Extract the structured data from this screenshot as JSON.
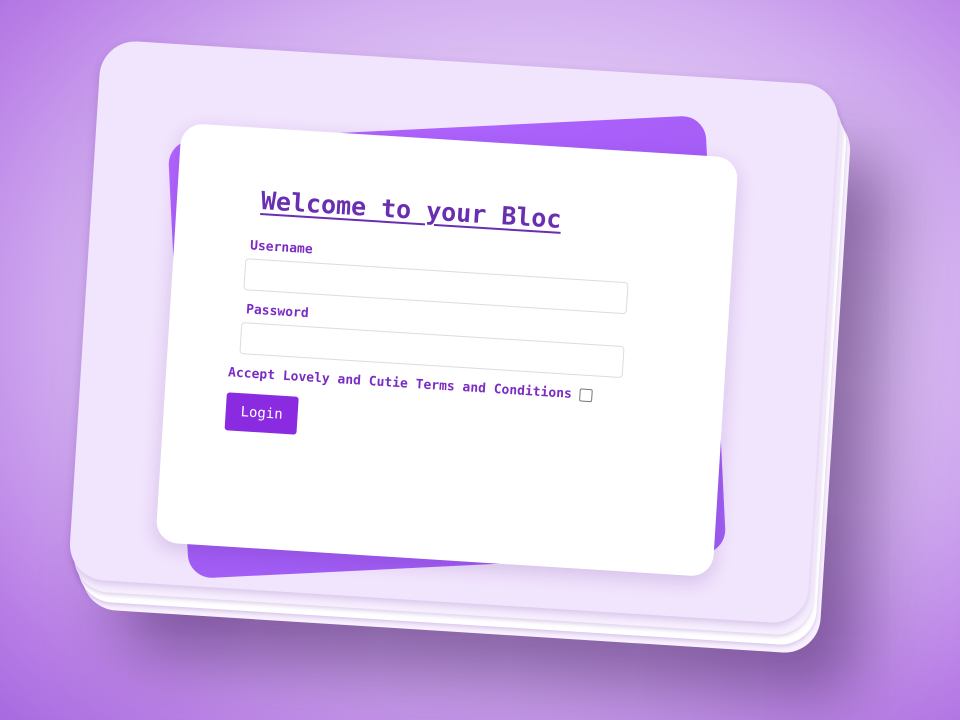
{
  "form": {
    "title": "Welcome to your Bloc",
    "username_label": "Username",
    "username_value": "",
    "password_label": "Password",
    "password_value": "",
    "terms_label": "Accept Lovely and Cutie Terms and Conditions",
    "terms_checked": false,
    "login_label": "Login"
  },
  "colors": {
    "accent": "#8a2be2",
    "label_text": "#7b2dc3",
    "title_text": "#6a2fb0",
    "card_background": "#ffffff",
    "back_card": "#a35cf6",
    "page_background": "#d2aef0"
  }
}
